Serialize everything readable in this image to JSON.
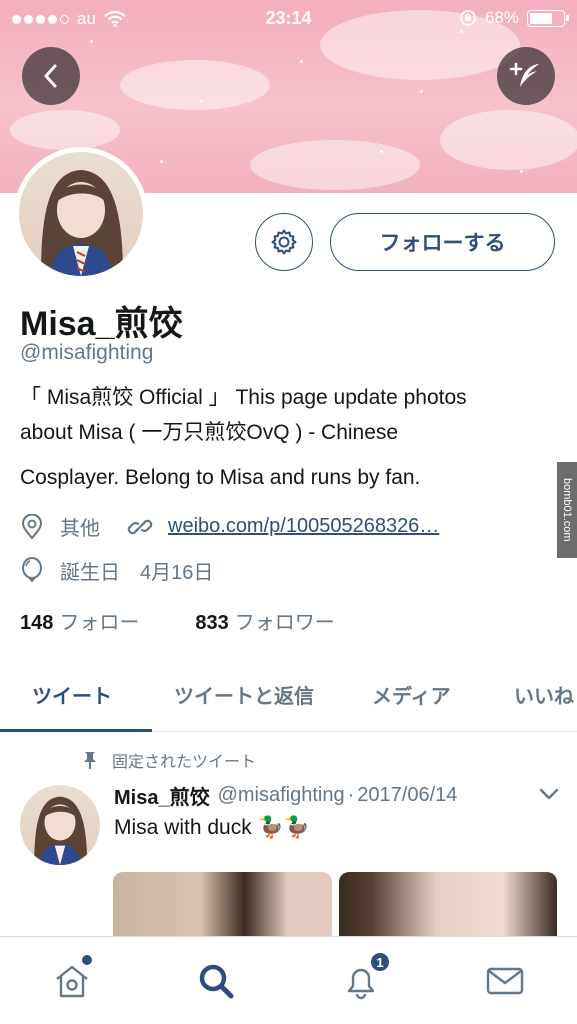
{
  "status_bar": {
    "carrier": "au",
    "time": "23:14",
    "battery_percent": "68%",
    "battery_level": 0.68
  },
  "header": {
    "back_icon": "chevron-left-icon",
    "compose_icon": "plus-feather-icon"
  },
  "profile": {
    "follow_label": "フォローする",
    "settings_icon": "gear-icon",
    "display_name": "Misa_煎饺",
    "handle": "@misafighting",
    "bio_line1": "「 Misa煎饺 Official 」 This page update photos",
    "bio_line2": "about Misa ( 一万只煎饺OvQ ) - Chinese",
    "bio_line3": "Cosplayer. Belong to Misa and runs by fan.",
    "location": "其他",
    "website": "weibo.com/p/100505268326…",
    "birthday": "誕生日　4月16日",
    "following_count": "148",
    "following_label": "フォロー",
    "followers_count": "833",
    "followers_label": "フォロワー"
  },
  "watermark": "bomb01.com",
  "tabs": [
    {
      "label": "ツイート",
      "active": true
    },
    {
      "label": "ツイートと返信",
      "active": false
    },
    {
      "label": "メディア",
      "active": false
    },
    {
      "label": "いいね",
      "active": false
    }
  ],
  "pinned_tweet": {
    "pinned_label": "固定されたツイート",
    "name": "Misa_煎饺",
    "handle": "@misafighting",
    "separator": "·",
    "date": "2017/06/14",
    "text": "Misa with duck 🦆🦆"
  },
  "bottom_bar": {
    "home_icon": "home-icon",
    "search_icon": "search-icon",
    "notifications_icon": "bell-icon",
    "notifications_badge": "1",
    "messages_icon": "envelope-icon"
  },
  "colors": {
    "accent": "#2f4f7a",
    "banner_pink": "#f3aebd",
    "secondary_text": "#657786"
  }
}
